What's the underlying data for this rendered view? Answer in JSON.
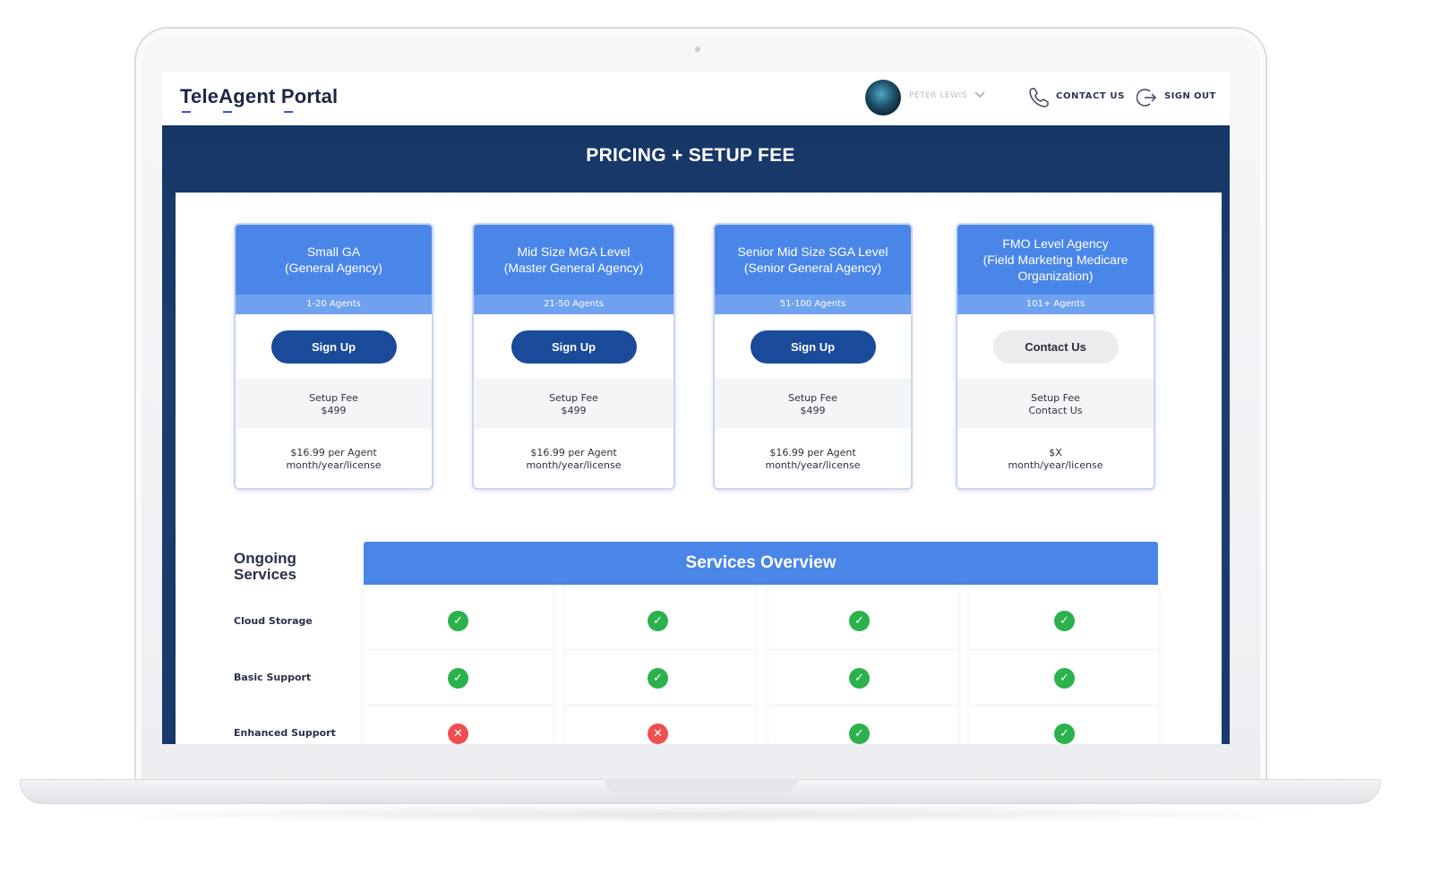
{
  "brand": {
    "name": "TeleAgent Portal"
  },
  "header": {
    "user_name": "PETER LEWIS",
    "contact_label": "CONTACT US",
    "signout_label": "SIGN OUT"
  },
  "page": {
    "title": "PRICING + SETUP FEE"
  },
  "plans": [
    {
      "title": "Small GA\n(General Agency)",
      "agents": "1-20 Agents",
      "button": "Sign Up",
      "fee_label": "Setup Fee",
      "fee_value": "$499",
      "price_line1": "$16.99 per Agent",
      "price_line2": "month/year/license"
    },
    {
      "title": "Mid Size MGA Level\n(Master General Agency)",
      "agents": "21-50 Agents",
      "button": "Sign Up",
      "fee_label": "Setup Fee",
      "fee_value": "$499",
      "price_line1": "$16.99 per Agent",
      "price_line2": "month/year/license"
    },
    {
      "title": "Senior Mid Size  SGA Level\n(Senior General Agency)",
      "agents": "51-100 Agents",
      "button": "Sign Up",
      "fee_label": "Setup Fee",
      "fee_value": "$499",
      "price_line1": "$16.99 per Agent",
      "price_line2": "month/year/license"
    },
    {
      "title": "FMO  Level Agency\n(Field Marketing Medicare\nOrganization)",
      "agents": "101+ Agents",
      "button": "Contact Us",
      "fee_label": "Setup Fee",
      "fee_value": "Contact Us",
      "price_line1": "$X",
      "price_line2": "month/year/license"
    }
  ],
  "services": {
    "side_title_line1": "Ongoing",
    "side_title_line2": "Services",
    "header": "Services Overview",
    "rows": [
      {
        "label": "Cloud Storage",
        "values": [
          "yes",
          "yes",
          "yes",
          "yes"
        ]
      },
      {
        "label": "Basic Support",
        "values": [
          "yes",
          "yes",
          "yes",
          "yes"
        ]
      },
      {
        "label": "Enhanced Support",
        "values": [
          "no",
          "no",
          "yes",
          "yes"
        ]
      }
    ]
  },
  "colors": {
    "accent": "#4a86e8",
    "primary_button": "#1a4a9a",
    "hero_bg": "#163766",
    "check": "#2bb24c",
    "cross": "#ef4f4f"
  },
  "icons": {
    "user_menu": "chevron-down-icon",
    "contact": "phone-icon",
    "signout": "sign-out-icon",
    "included": "check-circle-icon",
    "not_included": "x-circle-icon"
  }
}
